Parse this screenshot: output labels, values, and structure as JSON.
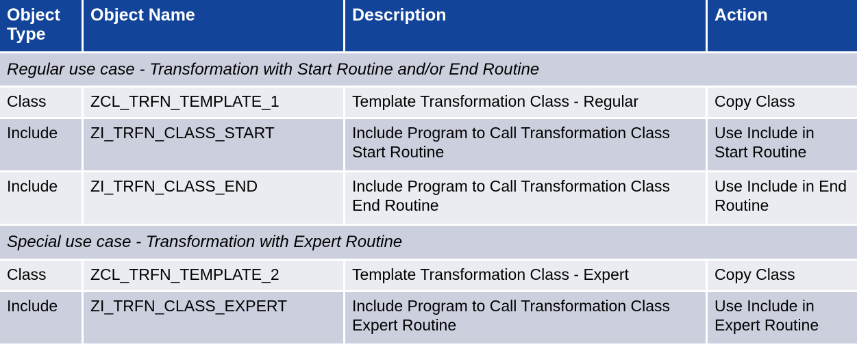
{
  "table": {
    "headers": [
      {
        "label": "Object Type",
        "name": "col-object-type"
      },
      {
        "label": "Object Name",
        "name": "col-object-name"
      },
      {
        "label": "Description",
        "name": "col-description"
      },
      {
        "label": "Action",
        "name": "col-action"
      }
    ],
    "colors": {
      "header_bg": "#12449a",
      "header_text": "#ffffff",
      "row_light": "#eaecf1",
      "row_dark": "#ccd0de",
      "section_bg": "#ccd0de",
      "grid": "#ffffff",
      "text": "#000000"
    },
    "sections": [
      {
        "title": "Regular use case - Transformation with Start Routine and/or End Routine",
        "rows": [
          {
            "object_type": "Class",
            "object_name": "ZCL_TRFN_TEMPLATE_1",
            "description": "Template Transformation Class - Regular",
            "action": "Copy Class"
          },
          {
            "object_type": "Include",
            "object_name": "ZI_TRFN_CLASS_START",
            "description": "Include Program to Call Transformation Class Start Routine",
            "action": "Use Include in Start Routine"
          },
          {
            "object_type": "Include",
            "object_name": "ZI_TRFN_CLASS_END",
            "description": "Include Program to Call Transformation Class End Routine",
            "action": "Use Include in End Routine"
          }
        ]
      },
      {
        "title": "Special use case - Transformation with Expert Routine",
        "rows": [
          {
            "object_type": "Class",
            "object_name": "ZCL_TRFN_TEMPLATE_2",
            "description": "Template Transformation Class - Expert",
            "action": "Copy Class"
          },
          {
            "object_type": "Include",
            "object_name": "ZI_TRFN_CLASS_EXPERT",
            "description": "Include Program to Call Transformation Class Expert Routine",
            "action": "Use Include in Expert Routine"
          }
        ]
      }
    ]
  }
}
